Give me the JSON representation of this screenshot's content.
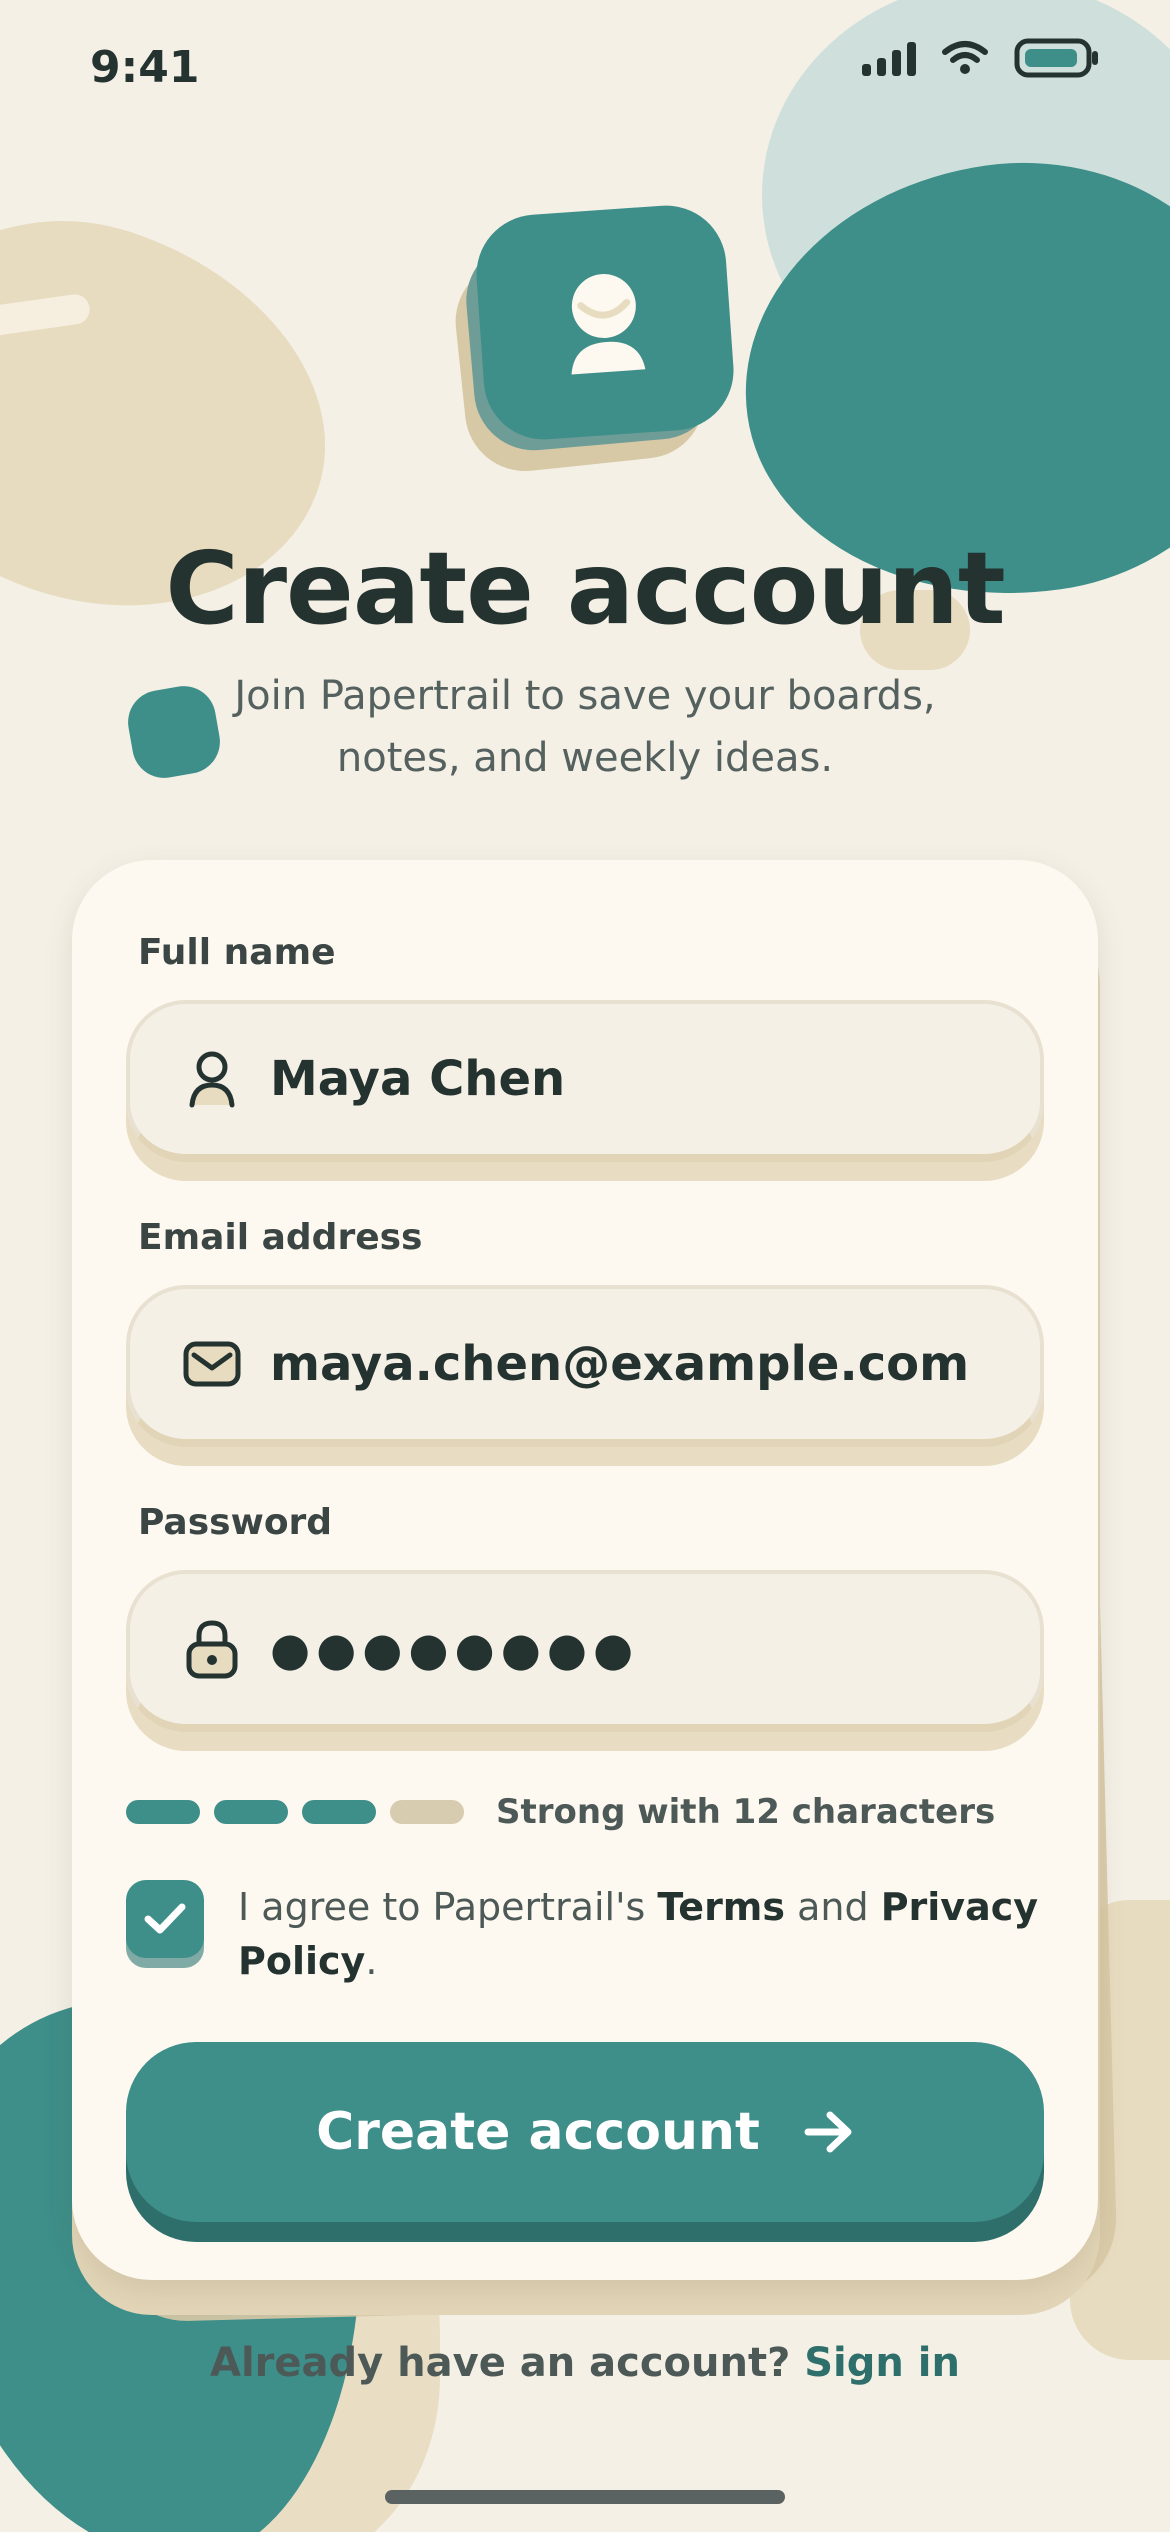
{
  "status_bar": {
    "time": "9:41",
    "icons": [
      "signal-icon",
      "wifi-icon",
      "battery-icon"
    ]
  },
  "header": {
    "logo_icon": "user-avatar-icon",
    "title": "Create account",
    "subtitle": "Join Papertrail to save your boards, notes, and weekly ideas."
  },
  "form": {
    "full_name": {
      "label": "Full name",
      "value": "Maya Chen",
      "icon": "person-icon"
    },
    "email": {
      "label": "Email address",
      "value": "maya.chen@example.com",
      "icon": "envelope-icon"
    },
    "password": {
      "label": "Password",
      "value": "●●●●●●●●",
      "icon": "lock-icon"
    },
    "strength": {
      "segments_filled": 3,
      "segments_total": 4,
      "text": "Strong with 12 characters"
    },
    "agree": {
      "checked": true,
      "prefix": "I agree to Papertrail's ",
      "terms": "Terms",
      "middle": " and ",
      "privacy": "Privacy Policy",
      "suffix": "."
    },
    "submit": {
      "label": "Create account",
      "icon": "arrow-right-icon"
    }
  },
  "footer": {
    "prompt": "Already have an account? ",
    "link": "Sign in"
  },
  "colors": {
    "background": "#f4f0e6",
    "accent": "#3e8e89",
    "accent_dark": "#2f6f6b",
    "sand": "#e8dcc0",
    "ink": "#243230",
    "strength_filled": "#3e8e89",
    "strength_empty": "#d8ccb0"
  }
}
